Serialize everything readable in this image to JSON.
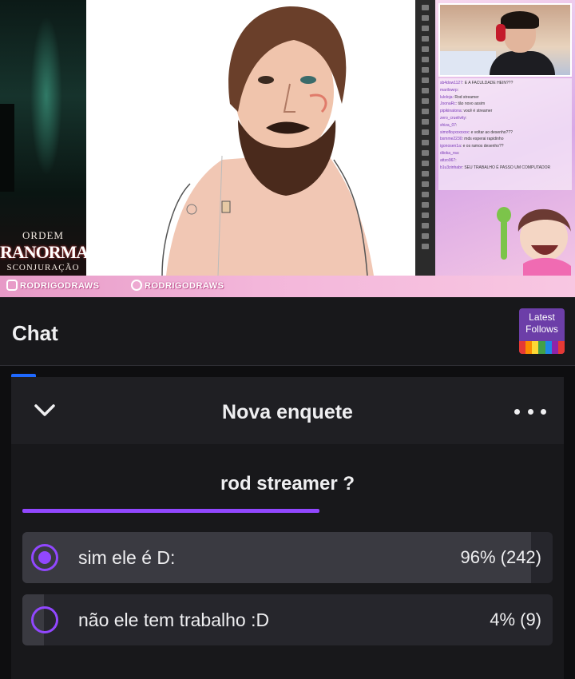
{
  "stream": {
    "left_logo": {
      "line1": "ORDEM",
      "line2": "RANORMAL",
      "line3": "SCONJURAÇÃO"
    },
    "handles": [
      "RODRIGODRAWS",
      "RODRIGODRAWS"
    ],
    "chat_overlay": [
      {
        "user": "sb4dow1127",
        "msg": "E A FACULDADE HEIN???"
      },
      {
        "user": "marilowrp",
        "msg": ""
      },
      {
        "user": "luloloja",
        "msg": "Rod streamer"
      },
      {
        "user": "JoonaRc",
        "msg": "tão novo assim"
      },
      {
        "user": "pipikinatona",
        "msg": "você é streamer"
      },
      {
        "user": "zero_cruelivity",
        "msg": ""
      },
      {
        "user": "shiza_07",
        "msg": ""
      },
      {
        "user": "simofloyxxxxxxx",
        "msg": "e voltar ao desenho???"
      },
      {
        "user": "bxmme2230",
        "msg": "mds esperai rapidinho"
      },
      {
        "user": "igonosen1a",
        "msg": "e os ramos desenho??"
      },
      {
        "user": "diioka_rsa",
        "msg": ""
      },
      {
        "user": "attzo967",
        "msg": ""
      },
      {
        "user": "b1u3zinhabr",
        "msg": "SEU TRABALHO É PASSO UM COMPUTADOR"
      }
    ]
  },
  "chat": {
    "title": "Chat",
    "latest_follows": {
      "line1": "Latest",
      "line2": "Follows"
    },
    "stripe_colors": [
      "#e53935",
      "#fb8c00",
      "#fdd835",
      "#43a047",
      "#1e88e5",
      "#8e24aa",
      "#e53935"
    ]
  },
  "poll": {
    "header_title": "Nova enquete",
    "question": "rod streamer ?",
    "progress": 0.56,
    "accent": "#9147ff",
    "options": [
      {
        "label": "sim ele é D:",
        "result": "96% (242)",
        "percent": 0.96,
        "selected": true
      },
      {
        "label": "não ele tem trabalho :D",
        "result": "4% (9)",
        "percent": 0.04,
        "selected": false
      }
    ]
  }
}
